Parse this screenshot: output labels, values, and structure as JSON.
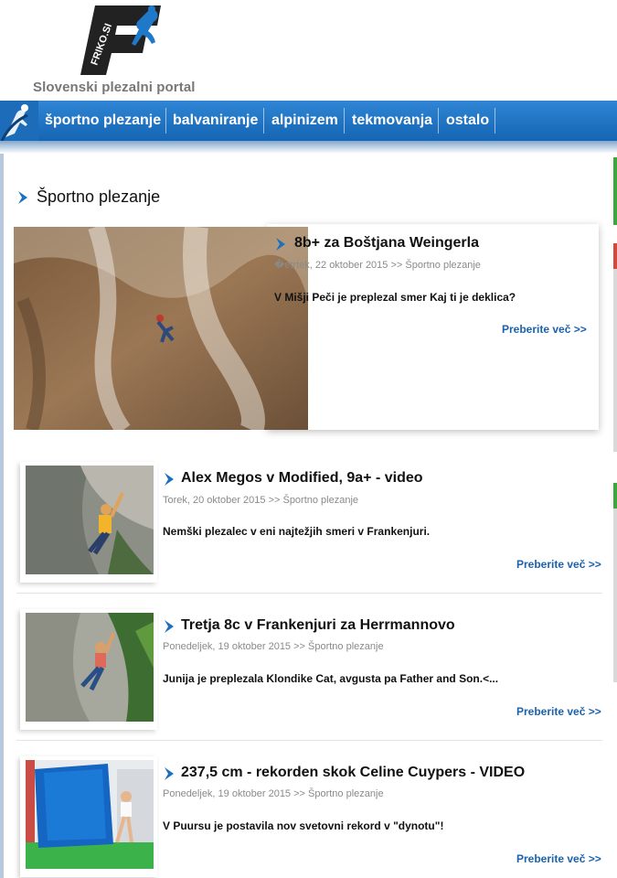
{
  "header": {
    "logo_text": "FRIKO.SI",
    "tagline": "Slovenski plezalni portal"
  },
  "nav": {
    "items": [
      {
        "label": "športno plezanje"
      },
      {
        "label": "balvaniranje"
      },
      {
        "label": "alpinizem"
      },
      {
        "label": "tekmovanja"
      },
      {
        "label": "ostalo"
      }
    ]
  },
  "section": {
    "title": "Športno plezanje"
  },
  "featured": {
    "title": "8b+ za Boštjana Weingerla",
    "meta": "�etrtek, 22 oktober 2015 >> Športno plezanje",
    "excerpt": "V Mišji Peči je preplezal smer Kaj ti je deklica?",
    "more": "Preberite več >>"
  },
  "articles": [
    {
      "title": "Alex Megos v Modified, 9a+ - video",
      "meta": "Torek, 20 oktober 2015 >> Športno plezanje",
      "excerpt": "Nemški plezalec v eni najtežjih smeri v Frankenjuri.",
      "more": "Preberite več >>"
    },
    {
      "title": "Tretja 8c v Frankenjuri za Herrmannovo",
      "meta": "Ponedeljek, 19 oktober 2015 >> Športno plezanje",
      "excerpt": "Junija je preplezala Klondike Cat, avgusta pa Father and Son.<...",
      "more": "Preberite več >>"
    },
    {
      "title": "237,5 cm - rekorden skok Celine Cuypers - VIDEO",
      "meta": "Ponedeljek, 19 oktober 2015 >> Športno plezanje",
      "excerpt": "V Puursu je postavila nov svetovni rekord v \"dynotu\"!",
      "more": "Preberite več >>"
    }
  ],
  "colors": {
    "nav_blue": "#1f72c2",
    "link_blue": "#1b62ad",
    "arrow_blue": "#1c6fc0",
    "stub_green": "#3aa83a",
    "stub_red": "#d24a3a"
  },
  "icons": {
    "logo": "friko-logo-climber",
    "nav_icon": "climber-icon",
    "section_arrow": "chevron-right-icon"
  }
}
